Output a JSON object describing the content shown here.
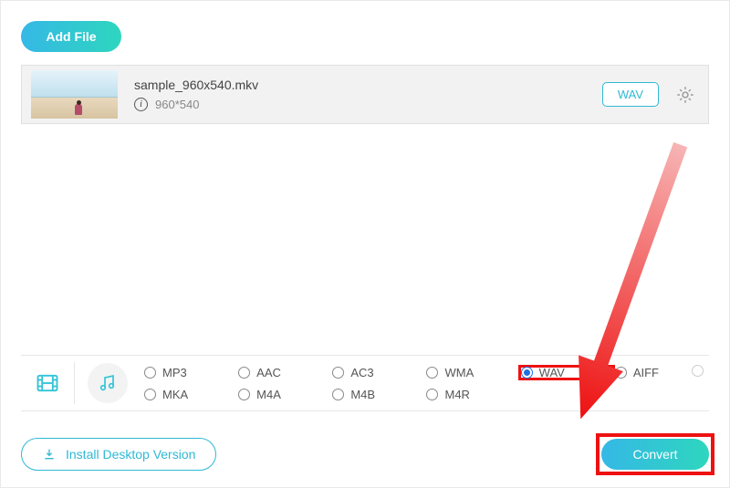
{
  "buttons": {
    "add_file": "Add File",
    "install_desktop": "Install Desktop Version",
    "convert": "Convert"
  },
  "file": {
    "name": "sample_960x540.mkv",
    "resolution": "960*540",
    "target_format": "WAV"
  },
  "formats": [
    {
      "label": "MP3",
      "selected": false,
      "row": 1
    },
    {
      "label": "AAC",
      "selected": false,
      "row": 1
    },
    {
      "label": "AC3",
      "selected": false,
      "row": 1
    },
    {
      "label": "WMA",
      "selected": false,
      "row": 1
    },
    {
      "label": "WAV",
      "selected": true,
      "row": 1,
      "highlight": true
    },
    {
      "label": "AIFF",
      "selected": false,
      "row": 1
    },
    {
      "label": "MKA",
      "selected": false,
      "row": 2
    },
    {
      "label": "M4A",
      "selected": false,
      "row": 2
    },
    {
      "label": "M4B",
      "selected": false,
      "row": 2
    },
    {
      "label": "M4R",
      "selected": false,
      "row": 2
    }
  ],
  "colors": {
    "accent_gradient_start": "#35b8e6",
    "accent_gradient_end": "#2ed6be",
    "accent_border": "#2fb9d4",
    "annotation": "#e11"
  }
}
